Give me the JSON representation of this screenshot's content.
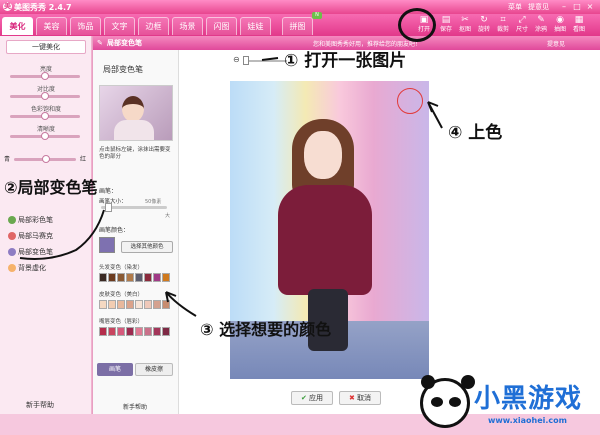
{
  "app": {
    "title": "美图秀秀 2.4.7",
    "menu": "菜单",
    "feedback": "提意见"
  },
  "tabs": [
    "美化",
    "美容",
    "饰品",
    "文字",
    "边框",
    "场景",
    "闪图",
    "娃娃",
    "拼图"
  ],
  "toolbar": [
    {
      "icon": "folder-icon",
      "label": "打开"
    },
    {
      "icon": "save-icon",
      "label": "保存"
    },
    {
      "icon": "crop-icon",
      "label": "抠图"
    },
    {
      "icon": "rotate-icon",
      "label": "旋转"
    },
    {
      "icon": "cut-icon",
      "label": "裁剪"
    },
    {
      "icon": "resize-icon",
      "label": "尺寸"
    },
    {
      "icon": "doodle-icon",
      "label": "涂鸦"
    },
    {
      "icon": "camera-icon",
      "label": "抽图"
    },
    {
      "icon": "view-icon",
      "label": "看图"
    }
  ],
  "left_panel": {
    "one_click": "一键美化",
    "sliders": [
      "亮度",
      "对比度",
      "色彩饱和度",
      "清晰度"
    ],
    "rb_left": "青",
    "rb_right": "红",
    "items": [
      "局部彩色笔",
      "局部马赛克",
      "局部变色笔",
      "背景虚化"
    ],
    "help": "新手帮助"
  },
  "tool_panel": {
    "header": "局部变色笔",
    "tip": "您和美图秀秀好用，推荐给您的朋友吧！",
    "feedback": "提意见",
    "title": "局部变色笔",
    "instruction": "点击鼠标左键，涂抹出需要变色的部分",
    "pen_label": "画笔：",
    "brush_size_label": "画笔大小：",
    "brush_max": "50像素",
    "brush_big": "大",
    "color_label": "画笔颜色：",
    "other_color": "选择其他颜色",
    "groups": [
      {
        "label": "头发变色（染发）",
        "colors": [
          "#3a2a23",
          "#6b3b1f",
          "#8a5a34",
          "#b07a4a",
          "#5c5d6e",
          "#8b2a3c",
          "#a03a86",
          "#d07a1e"
        ]
      },
      {
        "label": "皮肤变色（美白）",
        "colors": [
          "#f5d9c2",
          "#f2cdb2",
          "#e8b89c",
          "#dba28a",
          "#f7e3d6",
          "#efc8b9",
          "#d4a18f",
          "#c78c70"
        ]
      },
      {
        "label": "嘴唇变色（唇彩）",
        "colors": [
          "#b42d4b",
          "#c8455f",
          "#d65a7c",
          "#9d2a4f",
          "#e07a93",
          "#c9718a",
          "#a3365a",
          "#7e2944"
        ]
      }
    ],
    "pen_btn": "画笔",
    "eraser_btn": "橡皮擦",
    "help": "新手帮助",
    "current_color": "#7e71b0"
  },
  "canvas": {
    "apply": "应用",
    "cancel": "取消"
  },
  "annotations": {
    "step1": "① 打开一张图片",
    "step2": "②局部变色笔",
    "step3": "③ 选择想要的颜色",
    "step4": "④ 上色"
  },
  "brand": {
    "name": "小黑游戏",
    "url": "www.xiaohei.com"
  }
}
